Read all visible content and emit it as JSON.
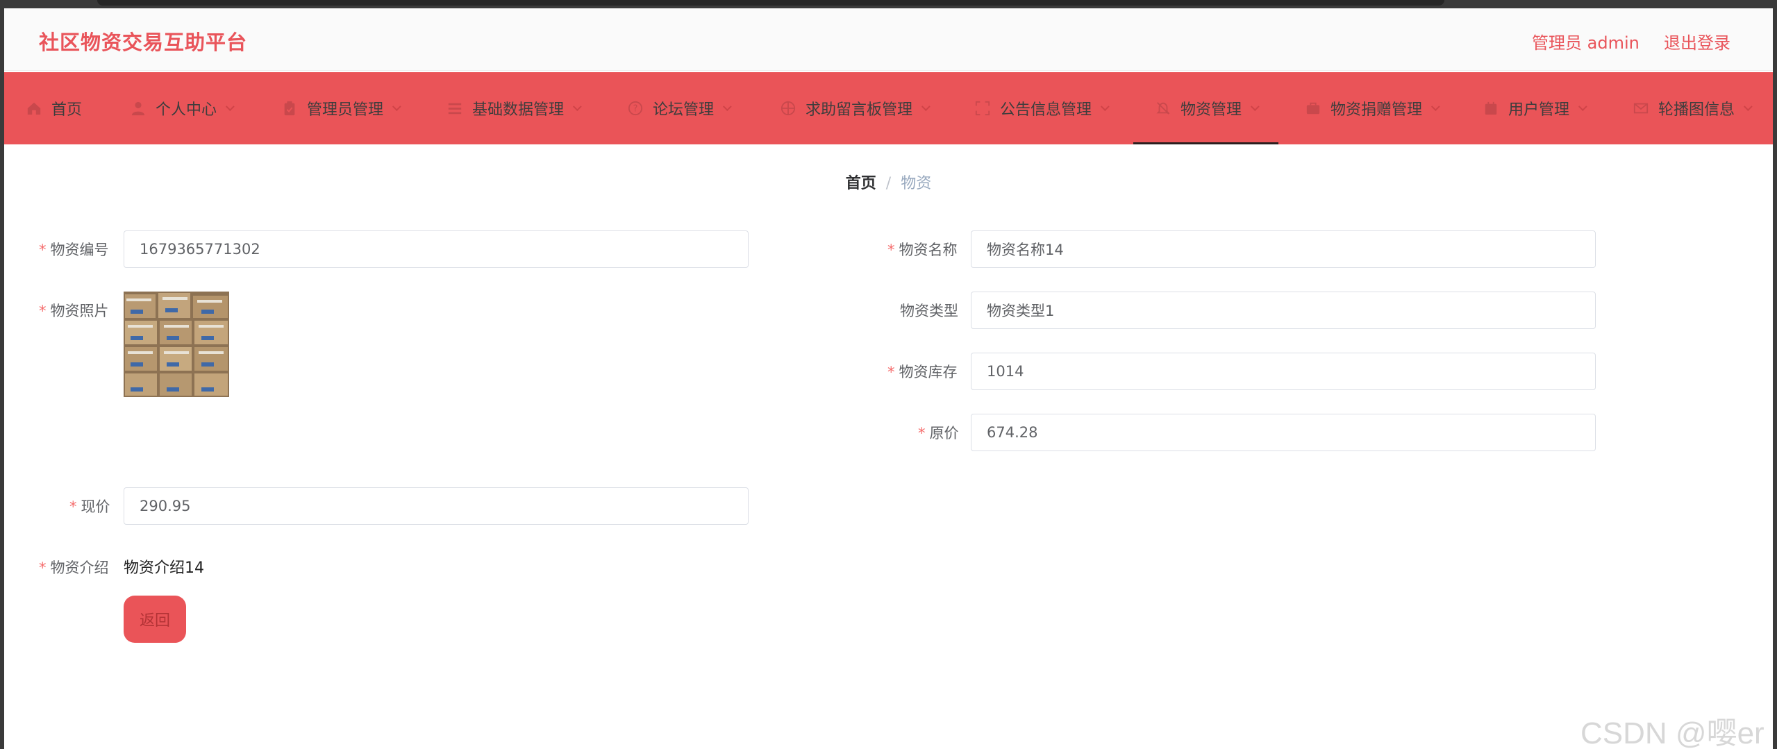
{
  "header": {
    "title": "社区物资交易互助平台",
    "admin_label": "管理员 admin",
    "logout_label": "退出登录"
  },
  "nav": {
    "items": [
      {
        "label": "首页",
        "icon": "home-icon"
      },
      {
        "label": "个人中心",
        "icon": "user-icon"
      },
      {
        "label": "管理员管理",
        "icon": "clipboard-icon"
      },
      {
        "label": "基础数据管理",
        "icon": "list-icon"
      },
      {
        "label": "论坛管理",
        "icon": "help-circle-icon"
      },
      {
        "label": "求助留言板管理",
        "icon": "globe-icon"
      },
      {
        "label": "公告信息管理",
        "icon": "fullscreen-icon"
      },
      {
        "label": "物资管理",
        "icon": "bell-off-icon"
      },
      {
        "label": "物资捐赠管理",
        "icon": "briefcase-icon"
      },
      {
        "label": "用户管理",
        "icon": "calendar-icon"
      },
      {
        "label": "轮播图信息",
        "icon": "mail-icon"
      }
    ],
    "active": "物资管理"
  },
  "breadcrumb": {
    "home": "首页",
    "separator": "/",
    "current": "物资"
  },
  "form": {
    "code_label": "物资编号",
    "code_value": "1679365771302",
    "name_label": "物资名称",
    "name_value": "物资名称14",
    "photo_label": "物资照片",
    "type_label": "物资类型",
    "type_value": "物资类型1",
    "stock_label": "物资库存",
    "stock_value": "1014",
    "orig_price_label": "原价",
    "orig_price_value": "674.28",
    "price_label": "现价",
    "price_value": "290.95",
    "intro_label": "物资介绍",
    "intro_value": "物资介绍14",
    "back_label": "返回",
    "required_mark": "*"
  },
  "watermark": "CSDN @嘤er",
  "colors": {
    "accent": "#ea5458",
    "brand_text": "#e9545a",
    "required": "#f56c6c"
  }
}
